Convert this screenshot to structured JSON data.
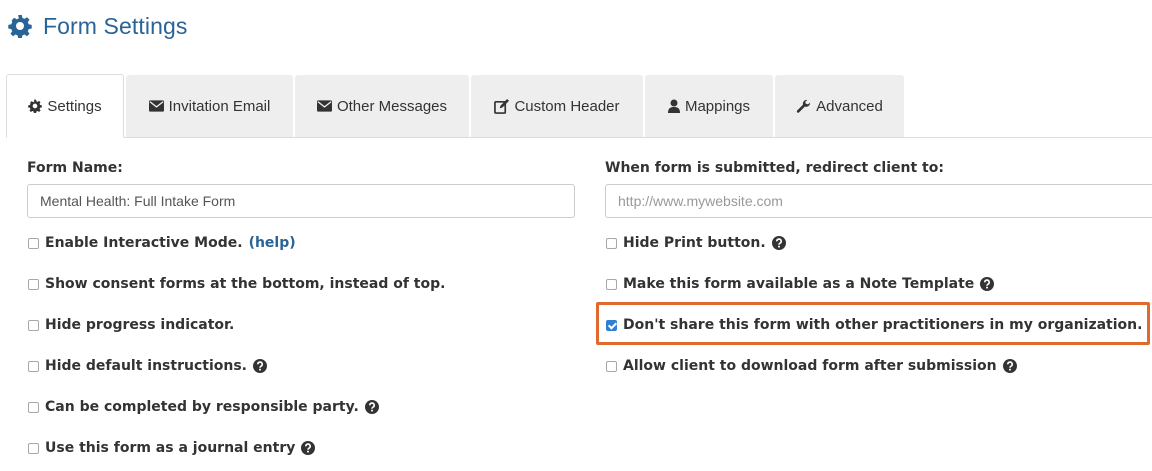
{
  "header": {
    "title": "Form Settings",
    "icon": "gear-icon",
    "color": "#2a6496"
  },
  "tabs": [
    {
      "label": "Settings",
      "icon": "gear-icon",
      "active": true
    },
    {
      "label": "Invitation Email",
      "icon": "envelope-icon"
    },
    {
      "label": "Other Messages",
      "icon": "envelope-icon"
    },
    {
      "label": "Custom Header",
      "icon": "edit-icon"
    },
    {
      "label": "Mappings",
      "icon": "user-icon"
    },
    {
      "label": "Advanced",
      "icon": "wrench-icon"
    }
  ],
  "form": {
    "name_label": "Form Name:",
    "name_value": "Mental Health: Full Intake Form",
    "redirect_label": "When form is submitted, redirect client to:",
    "redirect_placeholder": "http://www.mywebsite.com"
  },
  "left_options": [
    {
      "label": "Enable Interactive Mode.",
      "checked": false,
      "link": "(help)"
    },
    {
      "label": "Show consent forms at the bottom, instead of top.",
      "checked": false
    },
    {
      "label": "Hide progress indicator.",
      "checked": false
    },
    {
      "label": "Hide default instructions.",
      "checked": false,
      "help_icon": true
    },
    {
      "label": "Can be completed by responsible party.",
      "checked": false,
      "help_icon": true
    },
    {
      "label": "Use this form as a journal entry",
      "checked": false,
      "help_icon": true
    }
  ],
  "right_options": [
    {
      "label": "Hide Print button.",
      "checked": false,
      "help_icon": true
    },
    {
      "label": "Make this form available as a Note Template",
      "checked": false,
      "help_icon": true
    },
    {
      "label": "Don't share this form with other practitioners in my organization.",
      "checked": true,
      "highlighted": true
    },
    {
      "label": "Allow client to download form after submission",
      "checked": false,
      "help_icon": true
    }
  ],
  "colors": {
    "accent": "#2a6496",
    "highlight": "#e06a2e",
    "checkbox": "#2f80d1"
  }
}
